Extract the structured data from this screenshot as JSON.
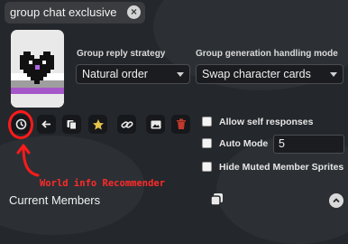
{
  "tag": {
    "label": "group chat exclusive",
    "remove_icon": "close-icon"
  },
  "settings": {
    "reply_strategy_label": "Group reply strategy",
    "reply_strategy_value": "Natural order",
    "handling_mode_label": "Group generation handling mode",
    "handling_mode_value": "Swap character cards"
  },
  "toolbar": {
    "icons": [
      "world-info-recommender-icon",
      "back-arrow-icon",
      "card-icon",
      "star-icon",
      "link-icon",
      "image-icon",
      "trash-icon"
    ],
    "colors": {
      "star": "#e6c34a",
      "trash": "#c0392b"
    }
  },
  "options": {
    "allow_self_responses": "Allow self responses",
    "auto_mode": "Auto Mode",
    "auto_mode_value": "5",
    "hide_muted_sprites": "Hide Muted Member Sprites"
  },
  "annotation": {
    "text": "World info Recommender",
    "color": "#ff2a2a"
  },
  "members": {
    "title": "Current Members",
    "copy_icon": "copy-icon",
    "collapse_icon": "chevron-up-icon"
  }
}
